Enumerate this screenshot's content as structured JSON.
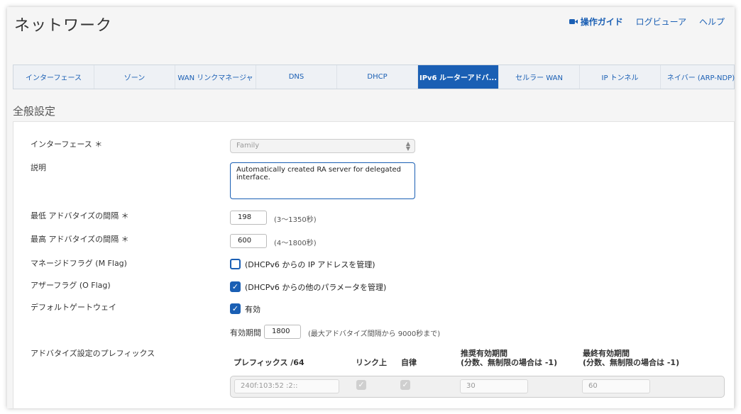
{
  "page": {
    "title": "ネットワーク"
  },
  "toplinks": {
    "guide": "操作ガイド",
    "log": "ログビューア",
    "help": "ヘルプ"
  },
  "tabs": [
    {
      "label": "インターフェース"
    },
    {
      "label": "ゾーン"
    },
    {
      "label": "WAN リンクマネージャ"
    },
    {
      "label": "DNS"
    },
    {
      "label": "DHCP"
    },
    {
      "label": "IPv6 ルーターアドバ..."
    },
    {
      "label": "セルラー WAN"
    },
    {
      "label": "IP トンネル"
    },
    {
      "label": "ネイバー (ARP-NDP)"
    }
  ],
  "section": {
    "title": "全般設定"
  },
  "form": {
    "interface": {
      "label": "インターフェース ＊",
      "value": "Family"
    },
    "description": {
      "label": "説明",
      "value": "Automatically created RA server for delegated interface."
    },
    "min_interval": {
      "label": "最低 アドバタイズの間隔 ＊",
      "value": "198",
      "hint": "(3〜1350秒)"
    },
    "max_interval": {
      "label": "最高 アドバタイズの間隔 ＊",
      "value": "600",
      "hint": "(4〜1800秒)"
    },
    "m_flag": {
      "label": "マネージドフラグ (M Flag)",
      "text": "(DHCPv6 からの IP アドレスを管理)",
      "checked": false
    },
    "o_flag": {
      "label": "アザーフラグ (O Flag)",
      "text": "(DHCPv6 からの他のパラメータを管理)",
      "checked": true
    },
    "default_gw": {
      "label": "デフォルトゲートウェイ",
      "text": "有効",
      "checked": true
    },
    "lifetime": {
      "label": "有効期間",
      "value": "1800",
      "hint": "(最大アドバタイズ間隔から 9000秒まで)"
    }
  },
  "prefix": {
    "label": "アドバタイズ設定のプレフィックス",
    "headers": {
      "prefix": "プレフィックス /64",
      "onlink": "リンク上",
      "auto": "自律",
      "preferred_1": "推奨有効期間",
      "preferred_2": "(分数、無制限の場合は -1)",
      "valid_1": "最終有効期間",
      "valid_2": "(分数、無制限の場合は -1)"
    },
    "row": {
      "prefix": "240f:103:52   :2::",
      "preferred": "30",
      "valid": "60"
    }
  },
  "colors": {
    "accent": "#1a5fb4"
  }
}
